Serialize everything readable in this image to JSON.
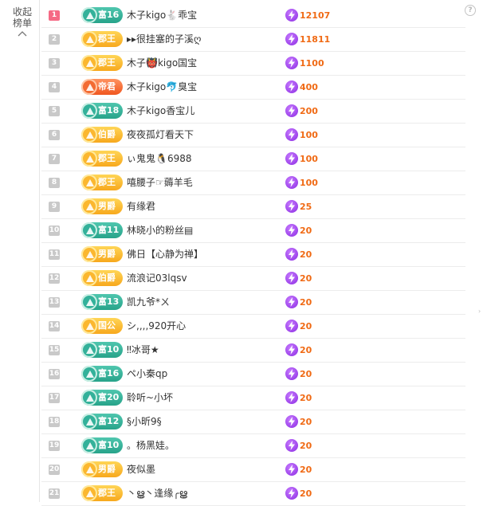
{
  "sidebar": {
    "collapse_label_1": "收起",
    "collapse_label_2": "榜单"
  },
  "help_icon_label": "?",
  "colors": {
    "fu_badge": "#2faa92",
    "gold_badge": "#f9b02a",
    "di_badge": "#f36b33",
    "rank_top": "#f56a85",
    "rank_default": "#c9c9c9",
    "value": "#f06a14"
  },
  "rows": [
    {
      "rank": "1",
      "badge": "富16",
      "badge_type": "fu",
      "name": "木子kigo🐇乖宝",
      "value": "12107"
    },
    {
      "rank": "2",
      "badge": "郡王",
      "badge_type": "gold",
      "name": "▸▸很挂塞的子溪ღ",
      "value": "11811"
    },
    {
      "rank": "3",
      "badge": "郡王",
      "badge_type": "gold",
      "name": "木子👹kigo国宝",
      "value": "1100"
    },
    {
      "rank": "4",
      "badge": "帝君",
      "badge_type": "di",
      "name": "木子kigo🐬臭宝",
      "value": "400"
    },
    {
      "rank": "5",
      "badge": "富18",
      "badge_type": "fu",
      "name": "木子kigo香宝儿",
      "value": "200"
    },
    {
      "rank": "6",
      "badge": "伯爵",
      "badge_type": "gold",
      "name": "夜夜孤灯看天下",
      "value": "100"
    },
    {
      "rank": "7",
      "badge": "郡王",
      "badge_type": "gold",
      "name": "ぃ鬼鬼🐧6988",
      "value": "100"
    },
    {
      "rank": "8",
      "badge": "郡王",
      "badge_type": "gold",
      "name": "嘻腰子☞薅羊毛",
      "value": "100"
    },
    {
      "rank": "9",
      "badge": "男爵",
      "badge_type": "gold",
      "name": "有缘君",
      "value": "25"
    },
    {
      "rank": "10",
      "badge": "富11",
      "badge_type": "fu",
      "name": "林晓小的粉丝▤",
      "value": "20"
    },
    {
      "rank": "11",
      "badge": "男爵",
      "badge_type": "gold",
      "name": "佛日【心静为禅】",
      "value": "20"
    },
    {
      "rank": "12",
      "badge": "伯爵",
      "badge_type": "gold",
      "name": "流浪记03lqsv",
      "value": "20"
    },
    {
      "rank": "13",
      "badge": "富13",
      "badge_type": "fu",
      "name": "凯九爷*ㄨ",
      "value": "20"
    },
    {
      "rank": "14",
      "badge": "国公",
      "badge_type": "gold",
      "name": "シ,,,,920开心",
      "value": "20"
    },
    {
      "rank": "15",
      "badge": "富10",
      "badge_type": "fu",
      "name": "‼冰哥★",
      "value": "20"
    },
    {
      "rank": "16",
      "badge": "富16",
      "badge_type": "fu",
      "name": "ペ小秦qp",
      "value": "20"
    },
    {
      "rank": "17",
      "badge": "富20",
      "badge_type": "fu",
      "name": "聆听~小坏",
      "value": "20"
    },
    {
      "rank": "18",
      "badge": "富12",
      "badge_type": "fu",
      "name": "§小昕9§",
      "value": "20"
    },
    {
      "rank": "19",
      "badge": "富10",
      "badge_type": "fu",
      "name": "。杨黑娃。",
      "value": "20"
    },
    {
      "rank": "20",
      "badge": "男爵",
      "badge_type": "gold",
      "name": "夜似墨",
      "value": "20"
    },
    {
      "rank": "21",
      "badge": "郡王",
      "badge_type": "gold",
      "name": "丶ൠ丶逢缘╭ൠ",
      "value": "20"
    }
  ]
}
